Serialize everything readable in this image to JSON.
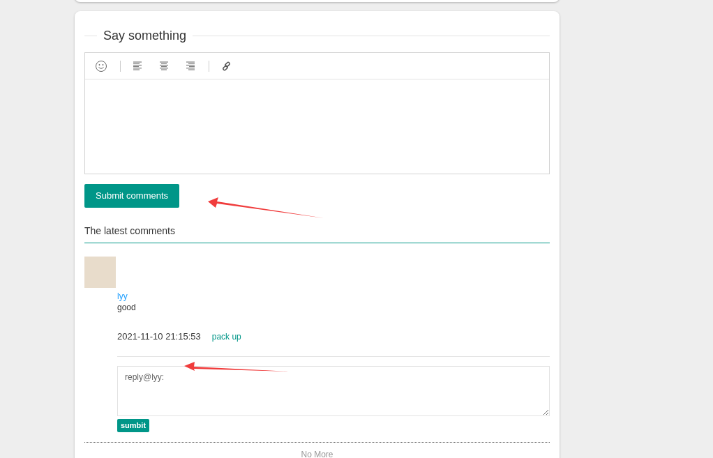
{
  "editor": {
    "title": "Say something",
    "submit_button": "Submit comments"
  },
  "comments_section": {
    "heading": "The latest comments",
    "comments": [
      {
        "author": "lyy",
        "text": "good",
        "time": "2021-11-10 21:15:53",
        "toggle": "pack up",
        "reply_placeholder": "reply@lyy:",
        "reply_button": "sumbit"
      }
    ],
    "footer": "No More"
  }
}
